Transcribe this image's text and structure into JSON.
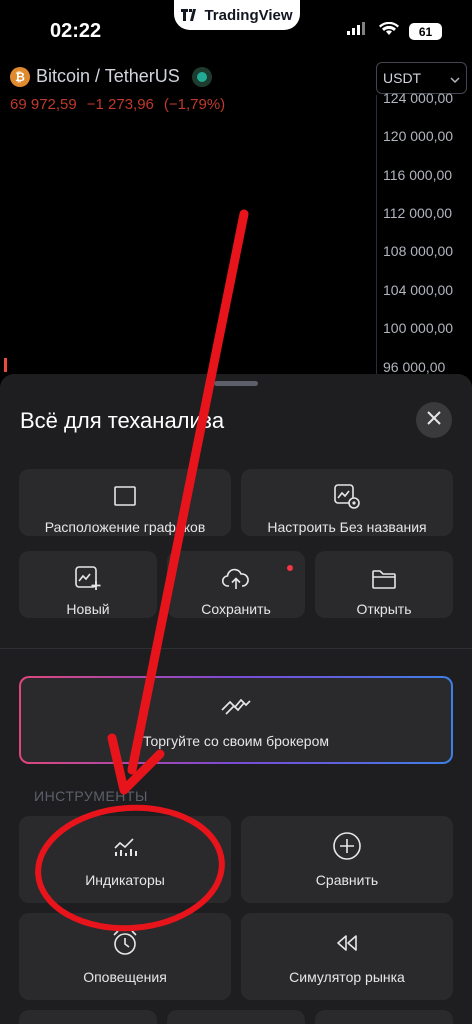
{
  "status_bar": {
    "time": "02:22",
    "app_badge": "TradingView",
    "battery": "61"
  },
  "chart": {
    "symbol": "Bitcoin / TetherUS",
    "coin_glyph": "₿",
    "price": "69 972,59",
    "change": "−1 273,96",
    "change_pct": "(−1,79%)",
    "currency": "USDT",
    "y_ticks": [
      "124 000,00",
      "120 000,00",
      "116 000,00",
      "112 000,00",
      "108 000,00",
      "104 000,00",
      "100 000,00",
      "96 000,00"
    ]
  },
  "sheet": {
    "title": "Всё для теханализа",
    "cards_top": [
      {
        "label": "Расположение графиков",
        "icon": "square-icon"
      },
      {
        "label": "Настроить Без названия",
        "icon": "chart-settings-icon"
      }
    ],
    "cards_mid": [
      {
        "label": "Новый",
        "icon": "new-chart-icon"
      },
      {
        "label": "Сохранить",
        "icon": "cloud-upload-icon"
      },
      {
        "label": "Открыть",
        "icon": "folder-icon"
      }
    ],
    "broker": {
      "label": "Торгуйте со своим брокером",
      "icon": "handshake-icon"
    },
    "tools_section": "ИНСТРУМЕНТЫ",
    "tools": [
      {
        "label": "Индикаторы",
        "icon": "indicators-icon"
      },
      {
        "label": "Сравнить",
        "icon": "plus-circle-icon"
      },
      {
        "label": "Оповещения",
        "icon": "alarm-icon"
      },
      {
        "label": "Симулятор рынка",
        "icon": "rewind-icon"
      }
    ]
  },
  "colors": {
    "accent_red": "#f23645",
    "annotation_red": "#e8141b",
    "sheet_bg": "#1e1e20",
    "card_bg": "#2a2a2d"
  }
}
